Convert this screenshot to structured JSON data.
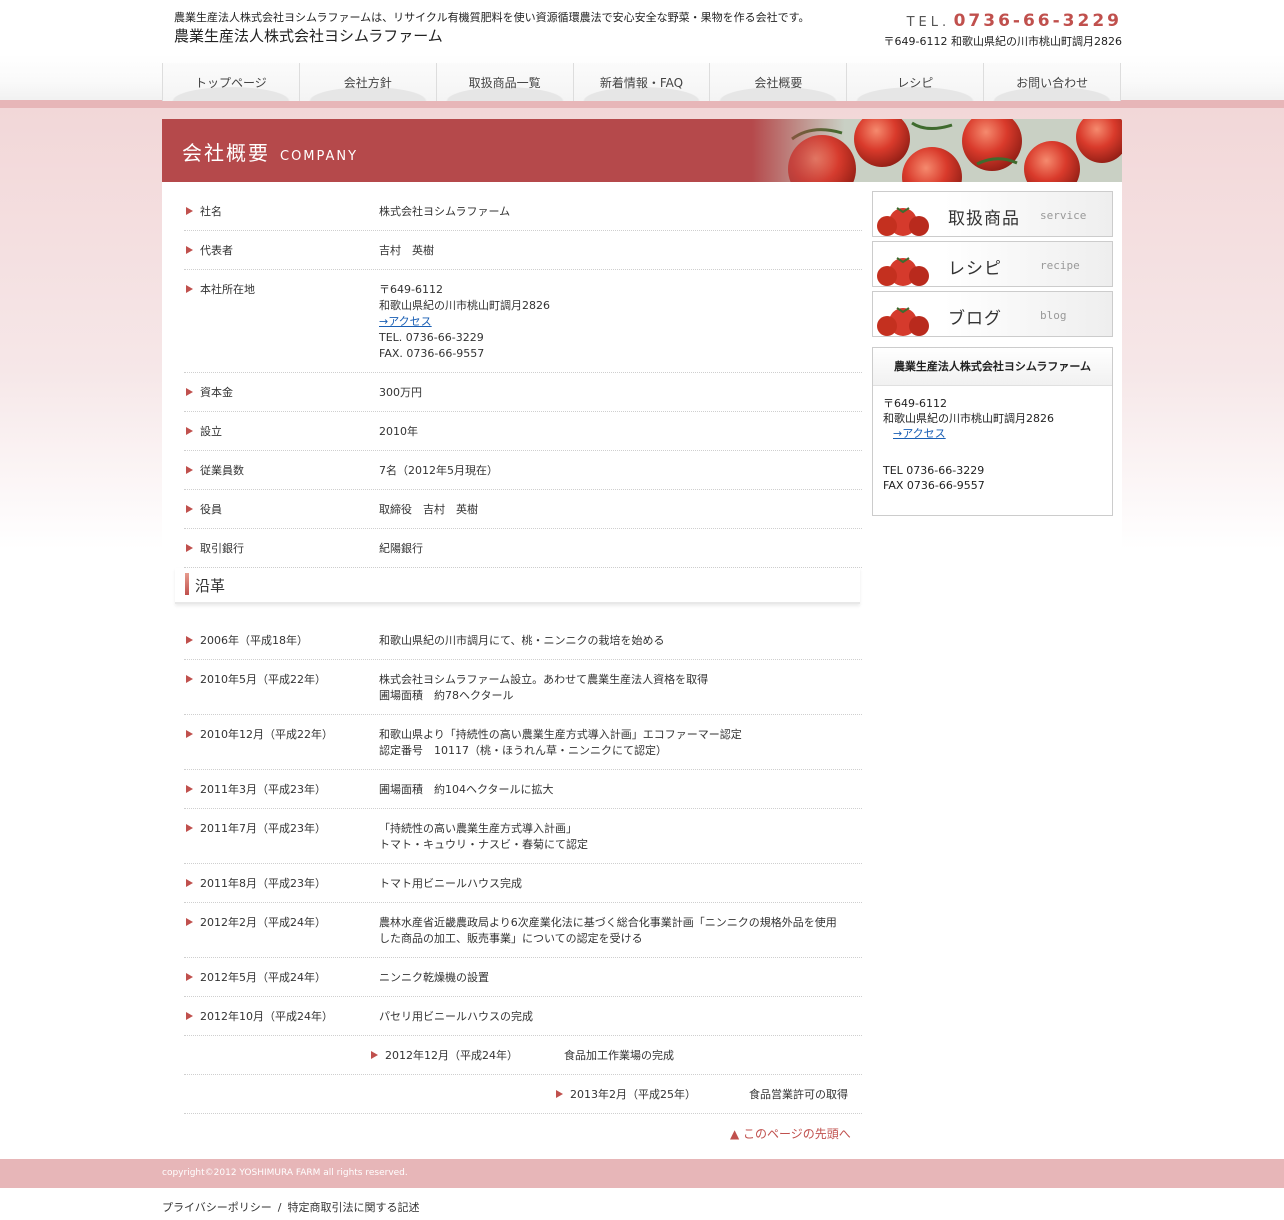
{
  "header": {
    "tagline": "農業生産法人株式会社ヨシムラファームは、リサイクル有機質肥料を使い資源循環農法で安心安全な野菜・果物を作る会社です。",
    "company_name": "農業生産法人株式会社ヨシムラファーム",
    "tel_prefix": "TEL.",
    "tel_number": "0736-66-3229",
    "address": "〒649-6112 和歌山県紀の川市桃山町調月2826"
  },
  "nav": {
    "items": [
      "トップページ",
      "会社方針",
      "取扱商品一覧",
      "新着情報・FAQ",
      "会社概要",
      "レシピ",
      "お問い合わせ"
    ]
  },
  "banner": {
    "title": "会社概要",
    "subtitle": "COMPANY"
  },
  "company": [
    {
      "label": "社名",
      "lines": [
        "株式会社ヨシムラファーム"
      ]
    },
    {
      "label": "代表者",
      "lines": [
        "吉村　英樹"
      ]
    },
    {
      "label": "本社所在地",
      "lines": [
        "〒649-6112",
        "和歌山県紀の川市桃山町調月2826"
      ],
      "link": "→アクセス",
      "extra": [
        "TEL. 0736-66-3229",
        "FAX. 0736-66-9557"
      ]
    },
    {
      "label": "資本金",
      "lines": [
        "300万円"
      ]
    },
    {
      "label": "設立",
      "lines": [
        "2010年"
      ]
    },
    {
      "label": "従業員数",
      "lines": [
        "7名（2012年5月現在）"
      ]
    },
    {
      "label": "役員",
      "lines": [
        "取締役　吉村　英樹"
      ]
    },
    {
      "label": "取引銀行",
      "lines": [
        "紀陽銀行"
      ]
    }
  ],
  "history_heading": "沿革",
  "history": [
    {
      "label": "2006年（平成18年）",
      "lines": [
        "和歌山県紀の川市調月にて、桃・ニンニクの栽培を始める"
      ]
    },
    {
      "label": "2010年5月（平成22年）",
      "lines": [
        "株式会社ヨシムラファーム設立。あわせて農業生産法人資格を取得",
        "圃場面積　約78ヘクタール"
      ]
    },
    {
      "label": "2010年12月（平成22年）",
      "lines": [
        "和歌山県より「持続性の高い農業生産方式導入計画」エコファーマー認定",
        "認定番号　10117（桃・ほうれん草・ニンニクにて認定）"
      ]
    },
    {
      "label": "2011年3月（平成23年）",
      "lines": [
        "圃場面積　約104ヘクタールに拡大"
      ]
    },
    {
      "label": "2011年7月（平成23年）",
      "lines": [
        "「持続性の高い農業生産方式導入計画」",
        "トマト・キュウリ・ナスビ・春菊にて認定"
      ]
    },
    {
      "label": "2011年8月（平成23年）",
      "lines": [
        "トマト用ビニールハウス完成"
      ]
    },
    {
      "label": "2012年2月（平成24年）",
      "lines": [
        "農林水産省近畿農政局より6次産業化法に基づく総合化事業計画「ニンニクの規格外品を使用",
        "した商品の加工、販売事業」についての認定を受ける"
      ]
    },
    {
      "label": "2012年5月（平成24年）",
      "lines": [
        "ニンニク乾燥機の設置"
      ]
    },
    {
      "label": "2012年10月（平成24年）",
      "lines": [
        "パセリ用ビニールハウスの完成"
      ]
    },
    {
      "label": "2012年12月（平成24年）",
      "lines": [
        "食品加工作業場の完成"
      ],
      "indent": 1
    },
    {
      "label": "2013年2月（平成25年）",
      "lines": [
        "食品営業許可の取得"
      ],
      "indent": 2
    }
  ],
  "pagetop": "▲ このページの先頭へ",
  "sidebar": {
    "buttons": [
      {
        "jp": "取扱商品",
        "en": "service"
      },
      {
        "jp": "レシピ",
        "en": "recipe"
      },
      {
        "jp": "ブログ",
        "en": "blog"
      }
    ],
    "box_title": "農業生産法人株式会社ヨシムラファーム",
    "postal": "〒649-6112",
    "address": "和歌山県紀の川市桃山町調月2826",
    "access_link": "→アクセス",
    "tel": "TEL 0736-66-3229",
    "fax": "FAX 0736-66-9557"
  },
  "footer": {
    "copyright": "copyright©2012 YOSHIMURA FARM all rights reserved.",
    "links": [
      "プライバシーポリシー",
      "特定商取引法に関する記述"
    ],
    "separator": "/"
  },
  "colors": {
    "accent": "#c0504d",
    "banner": "#b5494b",
    "footer": "#e7b6b8"
  }
}
